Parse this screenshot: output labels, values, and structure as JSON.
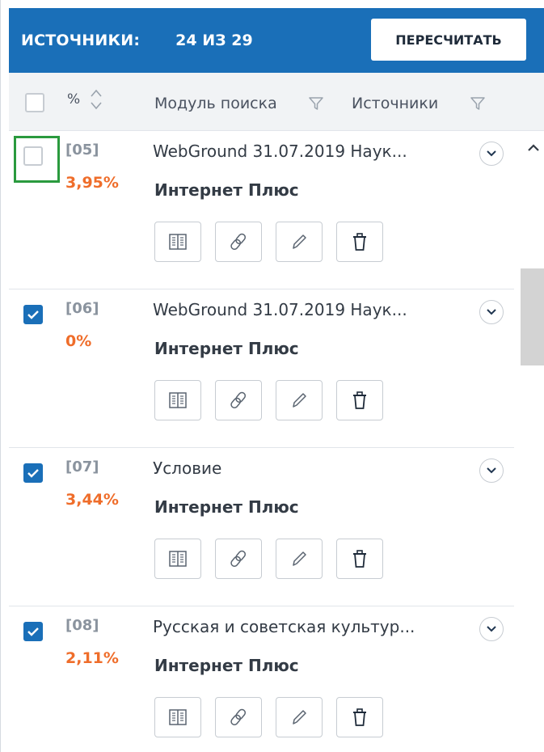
{
  "header": {
    "title": "ИСТОЧНИКИ:",
    "count": "24 ИЗ 29",
    "recalc_label": "ПЕРЕСЧИТАТЬ"
  },
  "columns": {
    "percent_label": "%",
    "module_label": "Модуль поиска",
    "sources_label": "Источники"
  },
  "rows": [
    {
      "num": "[05]",
      "percent": "3,95%",
      "name": "WebGround 31.07.2019 Наук...",
      "module": "Интернет Плюс",
      "checked": false
    },
    {
      "num": "[06]",
      "percent": "0%",
      "name": "WebGround 31.07.2019 Наук...",
      "module": "Интернет Плюс",
      "checked": true
    },
    {
      "num": "[07]",
      "percent": "3,44%",
      "name": "Условие",
      "module": "Интернет Плюс",
      "checked": true
    },
    {
      "num": "[08]",
      "percent": "2,11%",
      "name": "Русская и советская культур...",
      "module": "Интернет Плюс",
      "checked": true
    }
  ],
  "icons": {
    "sort": "sort-arrows-icon",
    "filter": "filter-funnel-icon",
    "expand": "chevron-down-icon",
    "actions": [
      "book-icon",
      "link-icon",
      "pencil-icon",
      "trash-icon"
    ],
    "scroll_up": "chevron-up-icon"
  },
  "colors": {
    "header_bg": "#1a6fb8",
    "percent": "#ef6d2a",
    "highlight": "#2a9a3e"
  }
}
